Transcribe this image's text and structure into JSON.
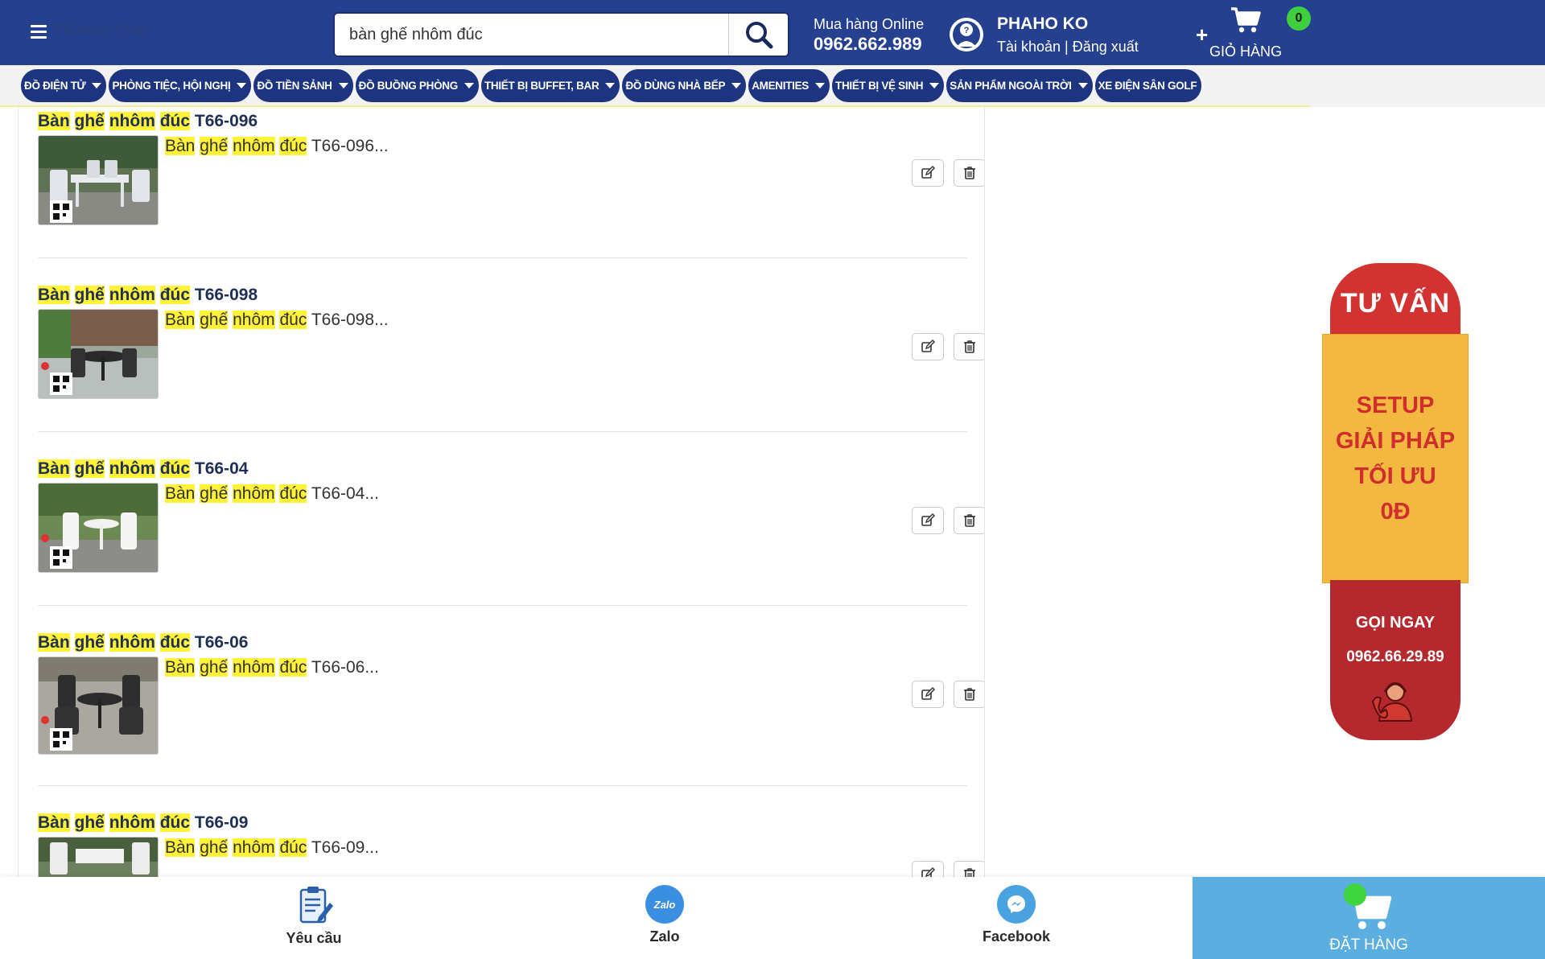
{
  "header": {
    "home_label": "TRANG CHỦ",
    "search_value": "bàn ghế nhôm đúc",
    "hotline_label": "Mua hàng Online",
    "hotline_number": "0962.662.989",
    "account_name": "PHAHO KO",
    "account_links": "Tài khoản | Đăng xuất",
    "cart_plus": "+",
    "cart_count": "0",
    "cart_label": "GIỎ HÀNG",
    "colors": {
      "bar": "#25408f",
      "badge": "#3ecf3e"
    }
  },
  "nav": {
    "items": [
      "ĐỒ ĐIỆN TỬ",
      "PHÒNG TIỆC, HỘI NGHỊ",
      "ĐỒ TIỀN SẢNH",
      "ĐỒ BUỒNG PHÒNG",
      "THIẾT BỊ BUFFET, BAR",
      "ĐỒ DÙNG NHÀ BẾP",
      "AMENITIES",
      "THIẾT BỊ VỆ SINH",
      "SẢN PHẨM NGOÀI TRỜI",
      "XE ĐIỆN SÂN GOLF"
    ]
  },
  "results": {
    "highlight_words": [
      "Bàn",
      "ghế",
      "nhôm",
      "đúc"
    ],
    "items": [
      {
        "code": "T66-096",
        "desc_code": "T66-096..."
      },
      {
        "code": "T66-098",
        "desc_code": "T66-098..."
      },
      {
        "code": "T66-04",
        "desc_code": "T66-04..."
      },
      {
        "code": "T66-06",
        "desc_code": "T66-06..."
      },
      {
        "code": "T66-09",
        "desc_code": "T66-09..."
      }
    ]
  },
  "consult_banner": {
    "top": "TƯ VẤN",
    "middle": [
      "SETUP",
      "GIẢI PHÁP",
      "TỐI ƯU",
      "0Đ"
    ],
    "call": "GỌI NGAY",
    "phone": "0962.66.29.89"
  },
  "bottom_bar": {
    "request": "Yêu cầu",
    "zalo": "Zalo",
    "zalo_logo": "Zalo",
    "facebook": "Facebook",
    "order": "ĐẶT HÀNG"
  }
}
